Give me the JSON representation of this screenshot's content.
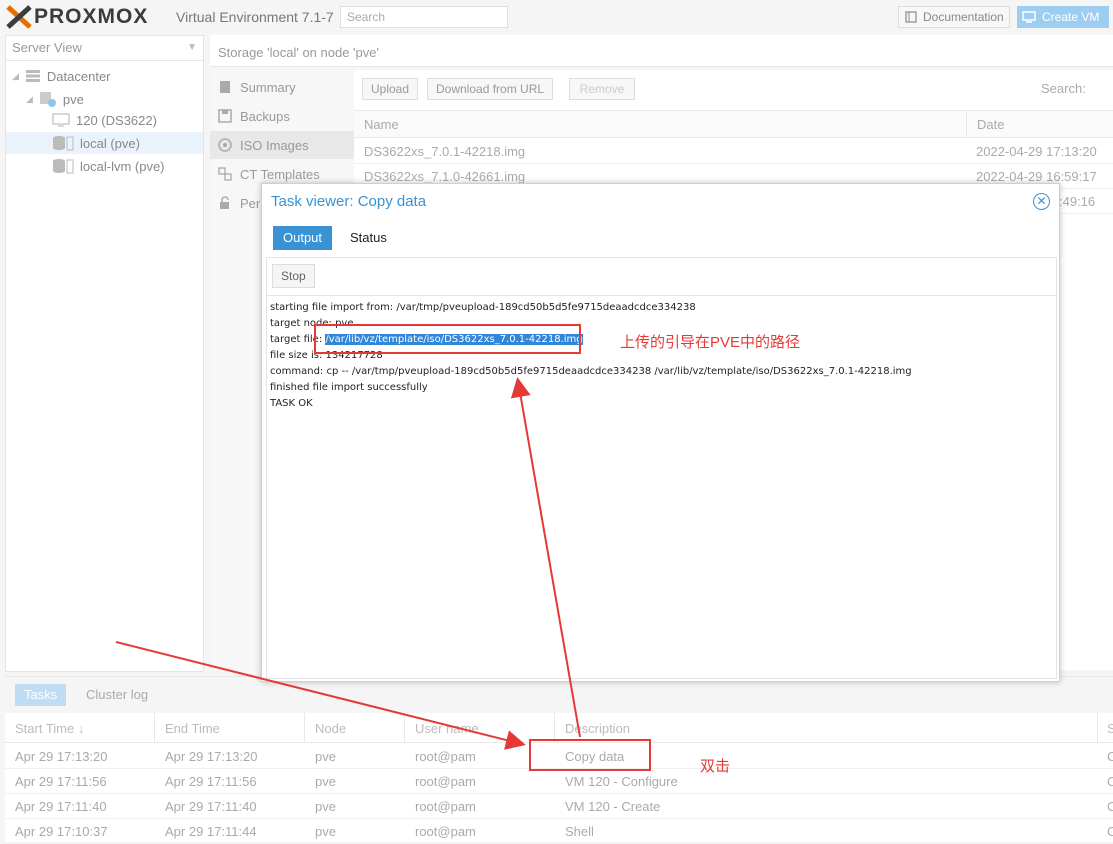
{
  "topbar": {
    "logo_text": "PROXMOX",
    "version": "Virtual Environment 7.1-7",
    "search_placeholder": "Search",
    "documentation_label": "Documentation",
    "create_vm_label": "Create VM"
  },
  "tree": {
    "view_label": "Server View",
    "items": [
      {
        "label": "Datacenter"
      },
      {
        "label": "pve"
      },
      {
        "label": "120 (DS3622)"
      },
      {
        "label": "local (pve)"
      },
      {
        "label": "local-lvm (pve)"
      }
    ]
  },
  "storage": {
    "title": "Storage 'local' on node 'pve'",
    "nav": [
      {
        "label": "Summary"
      },
      {
        "label": "Backups"
      },
      {
        "label": "ISO Images"
      },
      {
        "label": "CT Templates"
      },
      {
        "label": "Per"
      }
    ],
    "toolbar": {
      "upload": "Upload",
      "download": "Download from URL",
      "remove": "Remove",
      "search_label": "Search:"
    },
    "columns": {
      "name": "Name",
      "date": "Date"
    },
    "rows": [
      {
        "name": "DS3622xs_7.0.1-42218.img",
        "date": "2022-04-29 17:13:20"
      },
      {
        "name": "DS3622xs_7.1.0-42661.img",
        "date": "2022-04-29 16:59:17"
      },
      {
        "name": "",
        "date": ":49:16"
      }
    ]
  },
  "modal": {
    "title": "Task viewer: Copy data",
    "tab_output": "Output",
    "tab_status": "Status",
    "stop_label": "Stop",
    "lines": [
      "starting file import from: /var/tmp/pveupload-189cd50b5d5fe9715deaadcdce334238",
      "target node: pve",
      "target file: ",
      "file size is: 134217728",
      "command: cp -- /var/tmp/pveupload-189cd50b5d5fe9715deaadcdce334238 /var/lib/vz/template/iso/DS3622xs_7.0.1-42218.img",
      "finished file import successfully",
      "TASK OK"
    ],
    "highlight_path": "/var/lib/vz/template/iso/DS3622xs_7.0.1-42218.img"
  },
  "tasks": {
    "tab_tasks": "Tasks",
    "tab_cluster": "Cluster log",
    "columns": {
      "start": "Start Time ↓",
      "end": "End Time",
      "node": "Node",
      "user": "User name",
      "description": "Description",
      "status": "S"
    },
    "rows": [
      {
        "start": "Apr 29 17:13:20",
        "end": "Apr 29 17:13:20",
        "node": "pve",
        "user": "root@pam",
        "description": "Copy data",
        "status": "C"
      },
      {
        "start": "Apr 29 17:11:56",
        "end": "Apr 29 17:11:56",
        "node": "pve",
        "user": "root@pam",
        "description": "VM 120 - Configure",
        "status": "C"
      },
      {
        "start": "Apr 29 17:11:40",
        "end": "Apr 29 17:11:40",
        "node": "pve",
        "user": "root@pam",
        "description": "VM 120 - Create",
        "status": "C"
      },
      {
        "start": "Apr 29 17:10:37",
        "end": "Apr 29 17:11:44",
        "node": "pve",
        "user": "root@pam",
        "description": "Shell",
        "status": "C"
      }
    ]
  },
  "annotations": {
    "path_note": "上传的引导在PVE中的路径",
    "double_click_note": "双击",
    "color": "#e53935"
  },
  "colors": {
    "accent": "#3892d4",
    "logo_orange": "#e57000"
  }
}
